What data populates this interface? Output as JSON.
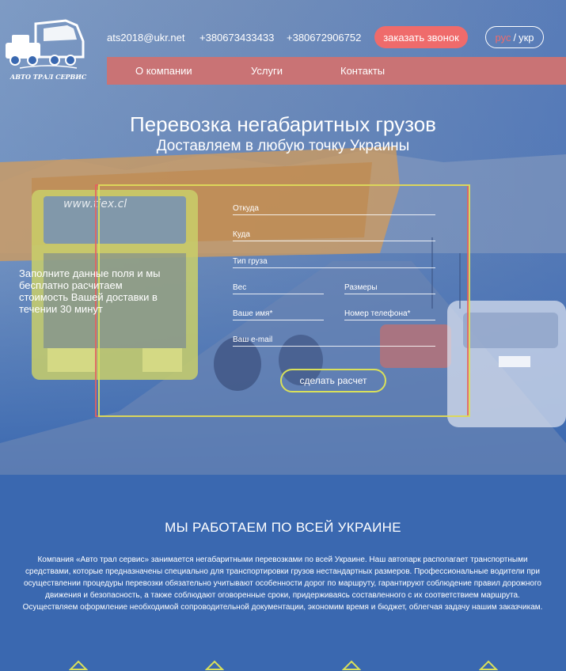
{
  "header": {
    "logo_caption": "АВТО ТРАЛ СЕРВИС",
    "email": "ats2018@ukr.net",
    "phone1": "+380673433433",
    "phone2": "+380672906752",
    "callback_label": "заказать звонок",
    "lang_ru": "рус",
    "lang_sep": "/",
    "lang_uk": "укр"
  },
  "nav": {
    "items": [
      "О компании",
      "Услуги",
      "Контакты"
    ]
  },
  "hero": {
    "title": "Перевозка негабаритных грузов",
    "subtitle": "Доставляем в любую точку Украины",
    "truck_plate_text": "www.tiex.cl"
  },
  "form": {
    "intro": "Заполните данные поля и мы бесплатно расчитаем стоимость Вашей доставки в течении 30 минут",
    "fields": {
      "from": "Откуда",
      "to": "Куда",
      "cargo_type": "Тип груза",
      "weight": "Вес",
      "dimensions": "Размеры",
      "name": "Ваше имя*",
      "phone": "Номер телефона*",
      "email": "Ваш e-mail"
    },
    "submit_label": "сделать расчет"
  },
  "about": {
    "title": "МЫ РАБОТАЕМ ПО ВСЕЙ УКРАИНЕ",
    "text": "Компания «Авто трал сервис» занимается негабаритными перевозками по всей Украине. Наш автопарк располагает транспортными средствами, которые предназначены специально для транспортировки грузов нестандартных размеров. Профессиональные водители при осуществлении процедуры перевозки обязательно учитывают особенности дорог по маршруту, гарантируют соблюдение правил дорожного движения и безопасность, а также соблюдают оговоренные сроки, придерживаясь составленного с их соответствием маршрута. Осуществляем оформление необходимой сопроводительной документации, экономим время и бюджет, облегчая задачу нашим заказчикам."
  },
  "colors": {
    "accent_red": "#ef6b6b",
    "nav_bg": "#c97375",
    "accent_yellow": "#d9e05a",
    "page_bg": "#3a68b0"
  }
}
